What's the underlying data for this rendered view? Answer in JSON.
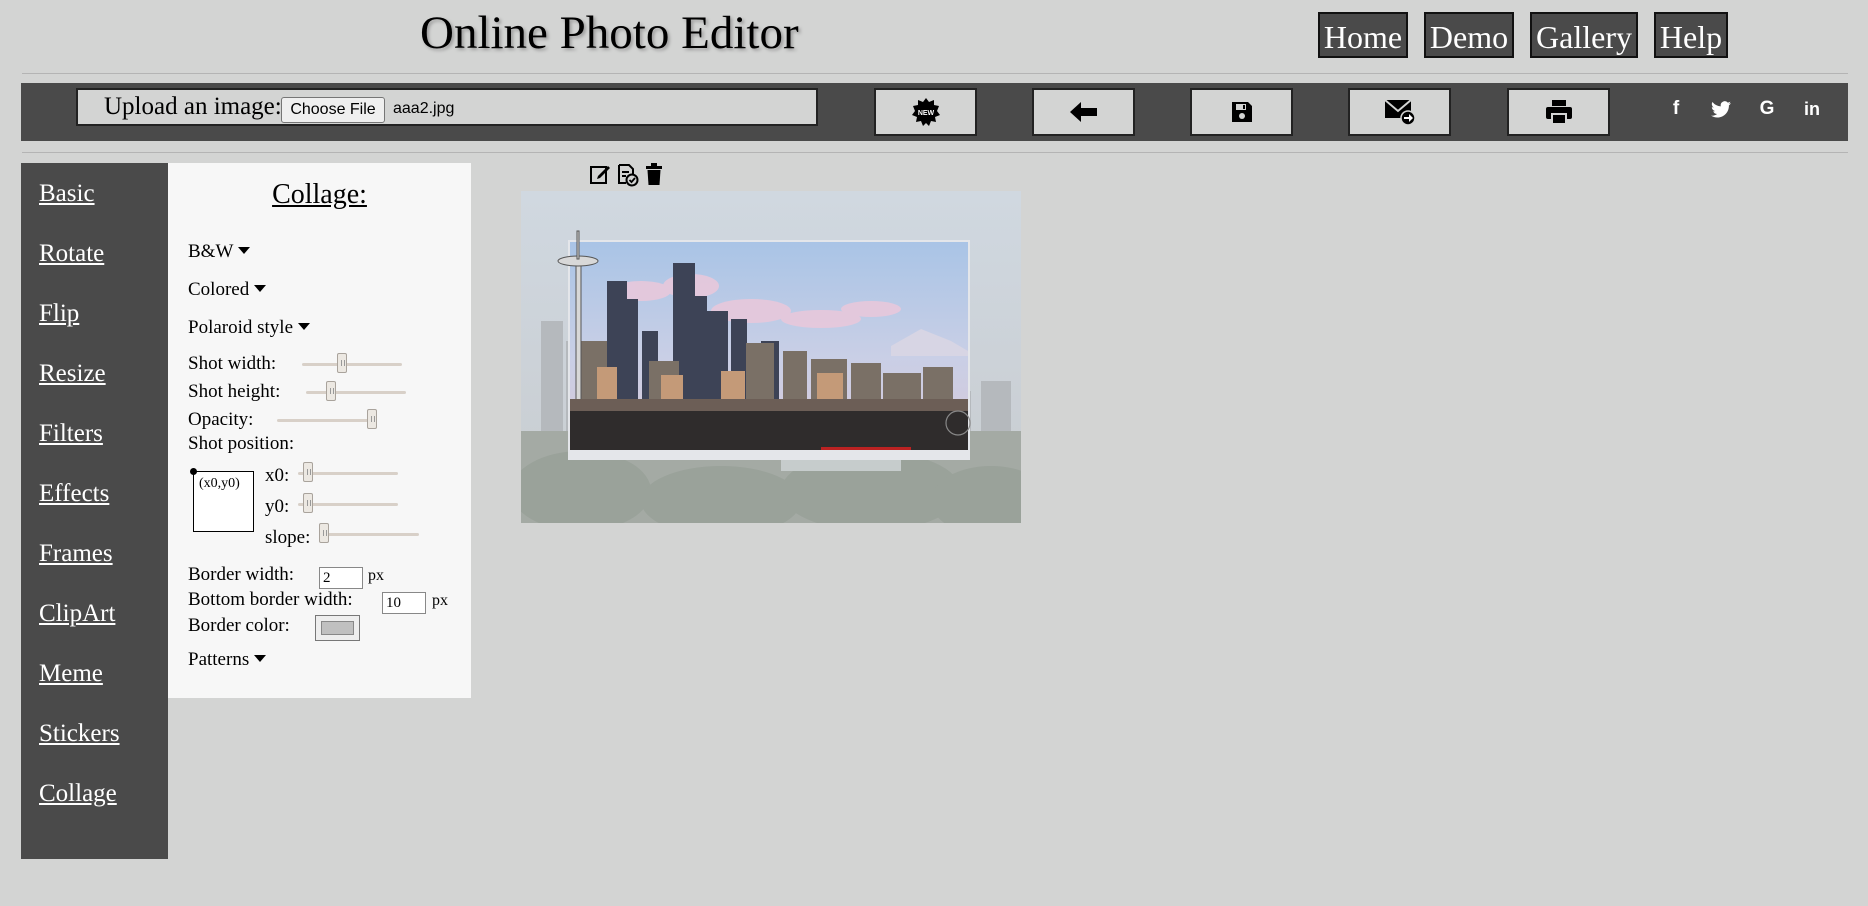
{
  "header": {
    "title": "Online Photo Editor",
    "nav": [
      {
        "label": "Home"
      },
      {
        "label": "Demo"
      },
      {
        "label": "Gallery"
      },
      {
        "label": "Help"
      }
    ]
  },
  "toolbar": {
    "upload_label": "Upload an image:",
    "choose_file_label": "Choose File",
    "file_name": "aaa2.jpg",
    "new_icon_text": "NEW",
    "buttons": [
      "new-icon",
      "undo-arrow-icon",
      "save-icon",
      "email-icon",
      "print-icon"
    ],
    "social": [
      {
        "icon": "facebook-icon",
        "glyph": "f"
      },
      {
        "icon": "twitter-icon",
        "glyph": "🐦"
      },
      {
        "icon": "google-icon",
        "glyph": "G"
      },
      {
        "icon": "linkedin-icon",
        "glyph": "in"
      }
    ]
  },
  "sidebar": {
    "items": [
      {
        "label": "Basic"
      },
      {
        "label": "Rotate"
      },
      {
        "label": "Flip"
      },
      {
        "label": "Resize"
      },
      {
        "label": "Filters"
      },
      {
        "label": "Effects"
      },
      {
        "label": "Frames"
      },
      {
        "label": "ClipArt"
      },
      {
        "label": "Meme"
      },
      {
        "label": "Stickers"
      },
      {
        "label": "Collage"
      }
    ]
  },
  "collage_panel": {
    "title": "Collage:",
    "bw_label": "B&W",
    "colored_label": "Colored",
    "polaroid_label": "Polaroid style",
    "shot_width_label": "Shot width:",
    "shot_width_level": 0.4,
    "shot_height_label": "Shot height:",
    "shot_height_level": 0.25,
    "opacity_label": "Opacity:",
    "opacity_level": 0.95,
    "shot_position_label": "Shot position:",
    "position_box_label": "(x0,y0)",
    "x0_label": "x0:",
    "x0_level": 0.1,
    "y0_label": "y0:",
    "y0_level": 0.1,
    "slope_label": "slope:",
    "slope_level": 0.05,
    "border_width_label": "Border width:",
    "border_width_value": "2",
    "bottom_border_width_label": "Bottom border width:",
    "bottom_border_width_value": "10",
    "px_unit": "px",
    "border_color_label": "Border color:",
    "border_color_value": "#c0c0c0",
    "patterns_label": "Patterns"
  },
  "image_tools": {
    "icons": [
      "edit-icon",
      "apply-icon",
      "delete-icon"
    ]
  },
  "colors": {
    "page_bg": "#d3d4d3",
    "dark_bar": "#4a4a4a",
    "panel_bg": "#f7f7f7"
  }
}
